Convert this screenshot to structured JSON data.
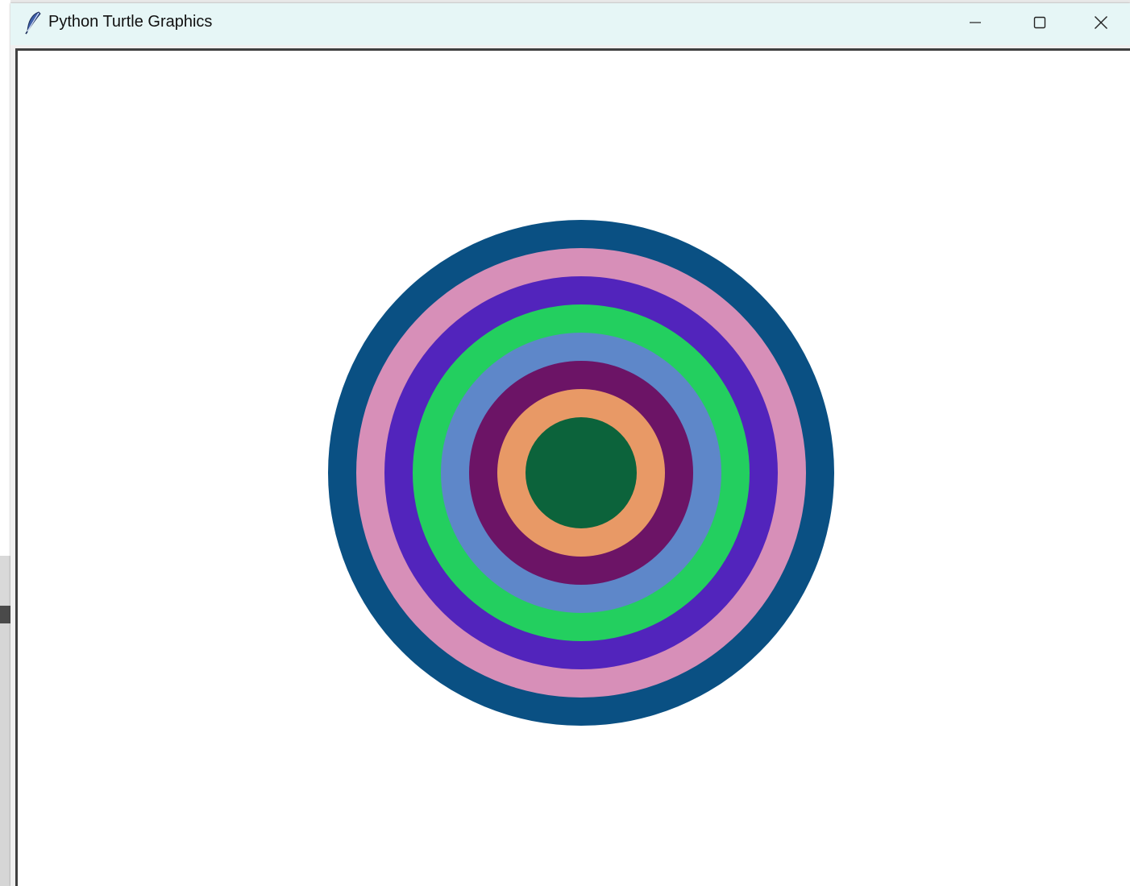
{
  "window": {
    "title": "Python Turtle Graphics",
    "icon": "feather-icon",
    "controls": {
      "minimize": "minimize-icon",
      "maximize": "maximize-icon",
      "close": "close-icon"
    }
  },
  "canvas": {
    "background": "#ffffff",
    "rings": [
      {
        "color": "#0a5083"
      },
      {
        "color": "#d78fb8"
      },
      {
        "color": "#5224bc"
      },
      {
        "color": "#23cf5f"
      },
      {
        "color": "#5e87c9"
      },
      {
        "color": "#6c1466"
      },
      {
        "color": "#e89966"
      },
      {
        "color": "#0c633b"
      }
    ]
  }
}
